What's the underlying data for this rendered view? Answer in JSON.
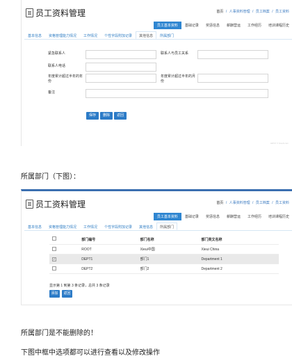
{
  "screenshot1": {
    "title": "员工资料管理",
    "breadcrumb": [
      "首页",
      "/",
      "人事资料管理",
      "/",
      "员工档案",
      "/",
      "员工资料"
    ],
    "top_tabs": [
      {
        "label": "员工基本资料",
        "active": true
      },
      {
        "label": "基础记录",
        "active": false
      },
      {
        "label": "奖惩信息",
        "active": false
      },
      {
        "label": "薪酬营运",
        "active": false
      },
      {
        "label": "工作经历",
        "active": false
      },
      {
        "label": "培训课程历史",
        "active": false
      }
    ],
    "sub_tabs": [
      {
        "label": "基本信息",
        "active": false
      },
      {
        "label": "资格管理能力情况",
        "active": false
      },
      {
        "label": "工作情况",
        "active": false
      },
      {
        "label": "个性字段附加记录",
        "active": false
      },
      {
        "label": "其他信息",
        "active": true
      },
      {
        "label": "所属部门",
        "active": false
      }
    ],
    "fields": {
      "emergency_contact": "紧急联系人",
      "relationship": "联系人与员工关系",
      "contact_phone": "联系人电话",
      "cumulative_leave_1": "年度累计超过半年的年份",
      "cumulative_leave_2": "年度累计超过半年的月份",
      "remark": "备注"
    },
    "buttons": {
      "save": "保存",
      "delete": "删除",
      "back": "返回"
    },
    "watermark": "HRS7 © hrsoft.com"
  },
  "caption1": "所属部门（下图）：",
  "screenshot2": {
    "title": "员工资料管理",
    "breadcrumb": [
      "首页",
      "/",
      "人事资料管理",
      "/",
      "员工档案",
      "/",
      "员工资料"
    ],
    "top_tabs": [
      {
        "label": "员工基本资料",
        "active": true
      },
      {
        "label": "基础记录",
        "active": false
      },
      {
        "label": "奖惩信息",
        "active": false
      },
      {
        "label": "薪酬营运",
        "active": false
      },
      {
        "label": "工作经历",
        "active": false
      },
      {
        "label": "培训课程历史",
        "active": false
      }
    ],
    "sub_tabs": [
      {
        "label": "基本信息",
        "active": false
      },
      {
        "label": "资格管理能力情况",
        "active": false
      },
      {
        "label": "工作情况",
        "active": false
      },
      {
        "label": "个性字段附加记录",
        "active": false
      },
      {
        "label": "其他信息",
        "active": false
      },
      {
        "label": "所属部门",
        "active": true
      }
    ],
    "table": {
      "headers": [
        "部门编号",
        "部门名称",
        "部门英文名称"
      ],
      "rows": [
        {
          "checked": false,
          "code": "ROOT",
          "name": "Xieui中国",
          "english": "Xieui China"
        },
        {
          "checked": true,
          "code": "DEPT1",
          "name": "部门1",
          "english": "Department 1"
        },
        {
          "checked": false,
          "code": "DEPT2",
          "name": "部门2",
          "english": "Department 2"
        }
      ]
    },
    "pager": "显示第 1 到第 3 条记录，总共 3 条记录",
    "buttons": {
      "add": "添加",
      "back": "返回"
    }
  },
  "caption2": "所属部门是不能删除的！",
  "caption3": "下图中框中选项都可以进行查看以及修改操作"
}
